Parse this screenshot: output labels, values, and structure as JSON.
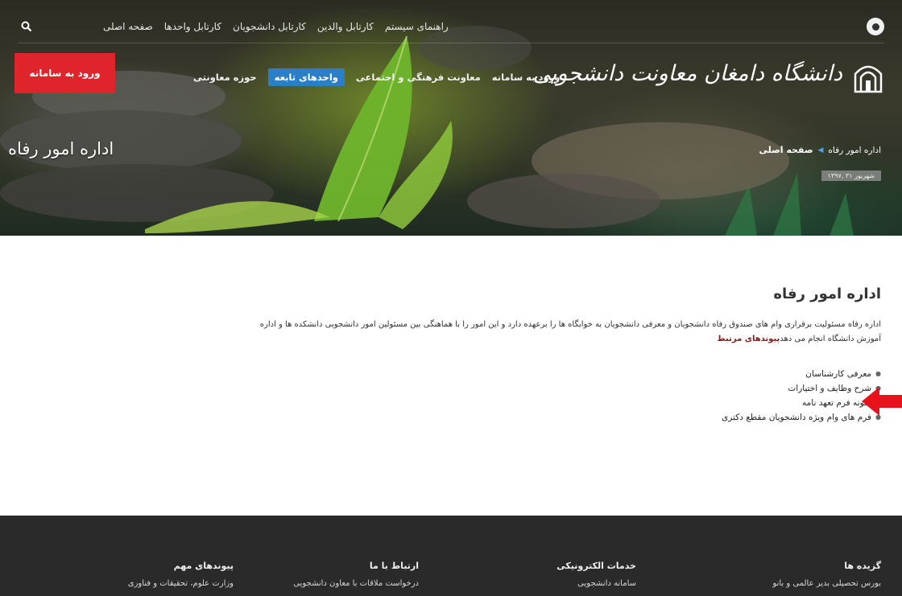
{
  "topbar": {
    "links": [
      "صفحه اصلی",
      "کارتابل واحدها",
      "کارتابل دانشجویان",
      "کارتابل والدین",
      "راهنمای سیستم"
    ]
  },
  "nav": {
    "items": [
      "حوزه معاونتی",
      "واحدهای تابعه",
      "معاونت فرهنگی و اجتماعی",
      "ورود به سامانه"
    ],
    "login_button": "ورود به سامانه",
    "active_color": "#2b7fc8",
    "login_color": "#e0242b"
  },
  "logo": {
    "text": "دانشگاه دامغان معاونت دانشجویی",
    "emblem_caption": "دانشگاه دامغان"
  },
  "hero": {
    "title": "اداره امور رفاه",
    "breadcrumb_home": "صفحه اصلی",
    "breadcrumb_current": "اداره امور رفاه",
    "date": "شهریور ۳۱ ,۱۳۹۷"
  },
  "content": {
    "heading": "اداره امور رفاه",
    "paragraph": "اداره رفاه مسئولیت برقراری وام های صندوق رفاه دانشجویان و معرفی دانشجویان به خوابگاه ها را برعهده دارد و این امور را با هماهنگی بین مسئولین امور دانشجویی دانشکده ها و اداره آموزش دانشگاه انجام می دهد",
    "related_label": "پیوندهای مرتبط",
    "links": [
      "معرفی کارشناسان",
      "شرح وظایف و اختیارات",
      "نمونه فرم تعهد نامه",
      "فرم های وام ویژه دانشجویان مقطع دکتری"
    ]
  },
  "footer": {
    "columns": [
      {
        "heading": "گزیده ها",
        "link": "بورس تحصیلی بدیر عالمی و بانو"
      },
      {
        "heading": "خدمات الکترونیکی",
        "link": "سامانه دانشجویی"
      },
      {
        "heading": "ارتباط با ما",
        "link": "درخواست ملاقات با معاون دانشجویی"
      },
      {
        "heading": "پیوندهای مهم",
        "link": "وزارت علوم، تحقیقات و فناوری"
      }
    ]
  },
  "icons": {
    "search": "search-icon",
    "account": "user-circle-icon",
    "arrow": "red-arrow-icon"
  }
}
